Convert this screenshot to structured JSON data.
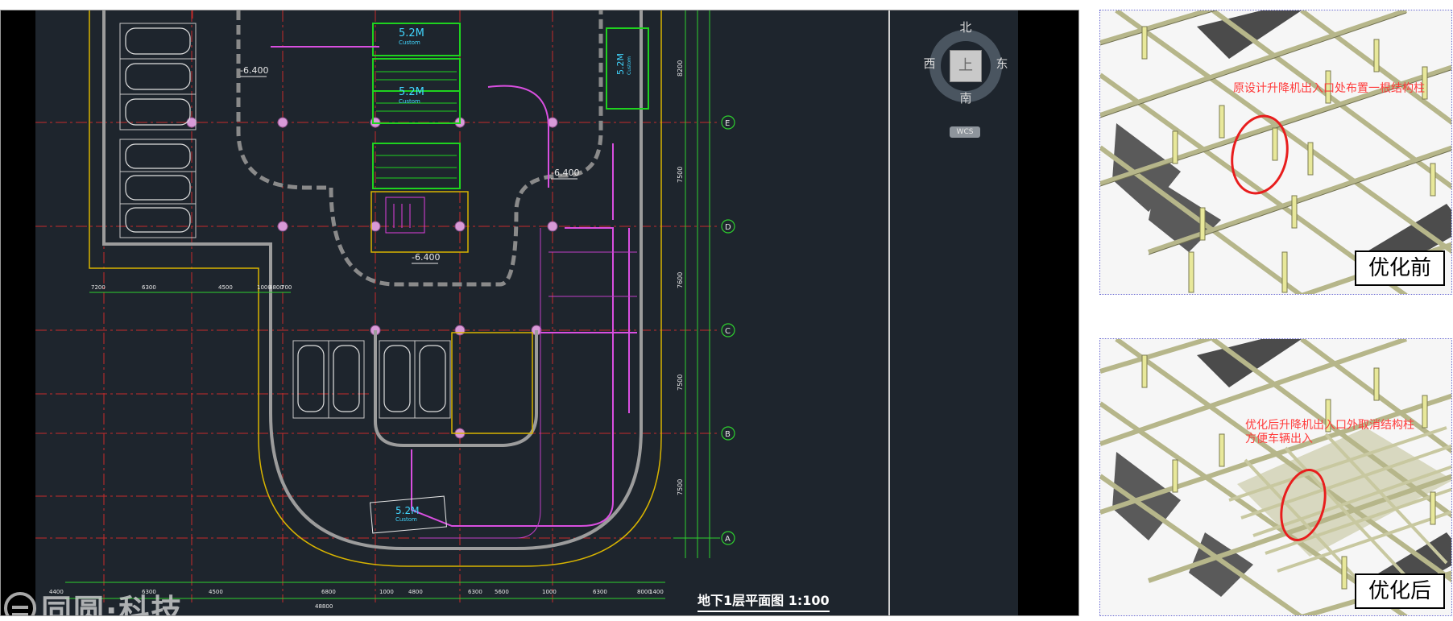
{
  "cad_plan": {
    "badges": [
      {
        "top": "5.2M",
        "bottom": "Custom"
      },
      {
        "top": "5.2M",
        "bottom": "Custom"
      },
      {
        "top": "5.2M",
        "bottom": "Custom"
      },
      {
        "top": "5.2M",
        "bottom": "Custom"
      }
    ],
    "elevations": [
      "-6.400",
      "-6.400",
      "-6.400"
    ],
    "compass": {
      "north": "北",
      "south": "南",
      "east": "东",
      "west": "西",
      "top_button": "上",
      "wcs": "WCS"
    },
    "grid_axes": [
      "E",
      "D",
      "C",
      "B",
      "A"
    ],
    "right_dimensions": [
      "8200",
      "7500",
      "7600",
      "7500",
      "7500"
    ],
    "top_dimension_row": [
      "7200",
      "6300",
      "4500",
      "1000",
      "4800",
      "700"
    ],
    "bottom_dimension_row": [
      "4400",
      "6300",
      "4500",
      "6800",
      "1000",
      "4800",
      "6300",
      "5600",
      "1000",
      "6300",
      "8000",
      "1400"
    ],
    "bottom_total": "48800",
    "drawing_title": "地下1层平面图 1:100",
    "drawing_subtitle": "",
    "watermark": "同圆·科技",
    "colors": {
      "background": "#1e252d",
      "axis_lines": "#c62a2a",
      "dimension_lines": "#2ed12e",
      "lift_badge": "#41d6ff",
      "route_lines": "#d94fe0",
      "walls": "#9c9c9c"
    }
  },
  "model_before": {
    "annotation": "原设计升降机出入口处布置一根结构柱",
    "caption": "优化前"
  },
  "model_after": {
    "annotation_line1": "优化后升降机出入口外取消结构柱",
    "annotation_line2": "方便车辆出入",
    "caption": "优化后"
  }
}
